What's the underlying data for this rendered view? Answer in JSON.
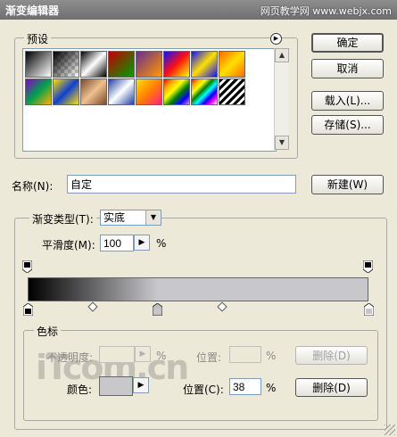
{
  "window": {
    "title": "渐变编辑器",
    "watermark": "网页教学网 www.webjx.com"
  },
  "presets": {
    "legend": "预设",
    "menu_icon": "circle-arrow-icon",
    "swatches": [
      "linear-gradient(135deg,#000,#fff)",
      "linear-gradient(135deg,#000 0%,rgba(0,0,0,0) 100%)",
      "linear-gradient(135deg,#000,#fff,#000)",
      "linear-gradient(135deg,#c00000,#00a000)",
      "linear-gradient(135deg,#6a2c8e,#ff9a00)",
      "linear-gradient(135deg,#1010ff,#ff1010,#ffff00)",
      "linear-gradient(135deg,#1010ff,#ffe000,#1010ff)",
      "linear-gradient(135deg,#ff6a00,#ffe000,#ff6a00)",
      "linear-gradient(135deg,#8a00c8,#00a050,#ffb000)",
      "linear-gradient(135deg,#ffe000,#1040d0,#ffe000)",
      "linear-gradient(135deg,#7a4a2a,#f0c090,#7a4a2a)",
      "linear-gradient(135deg,#2040a0,#ffffff,#2040a0)",
      "linear-gradient(135deg,#ffe000,#ff8000,#ff2080)",
      "linear-gradient(135deg,red,orange,yellow,green,blue,violet)",
      "linear-gradient(135deg,red,orange,yellow,green,cyan,blue,magenta,#fff)",
      "repeating-linear-gradient(135deg,#000 0 3px,#fff 3px 6px)"
    ]
  },
  "buttons": {
    "ok": "确定",
    "cancel": "取消",
    "load": "载入(L)...",
    "save": "存储(S)...",
    "new": "新建(W)",
    "delete_opacity": "删除(D)",
    "delete_color": "删除(D)"
  },
  "name": {
    "label": "名称(N):",
    "value": "自定"
  },
  "gradient": {
    "legend": "渐变类型(T):",
    "type_value": "实底",
    "smoothness_label": "平滑度(M):",
    "smoothness_value": "100",
    "smoothness_unit": "%",
    "start_color": "#000000",
    "end_color": "#c8c8cc",
    "color_stop_positions_percent": [
      0,
      38,
      100
    ],
    "midpoint_positions_percent": [
      19,
      57
    ]
  },
  "stops": {
    "legend": "色标",
    "opacity_label": "不透明度:",
    "opacity_unit": "%",
    "opacity_position_label": "位置:",
    "opacity_position_unit": "%",
    "color_label": "颜色:",
    "color_swatch": "#c8c8cc",
    "color_position_label": "位置(C):",
    "color_position_value": "38",
    "color_position_unit": "%"
  },
  "logo": "iTcom.cn"
}
